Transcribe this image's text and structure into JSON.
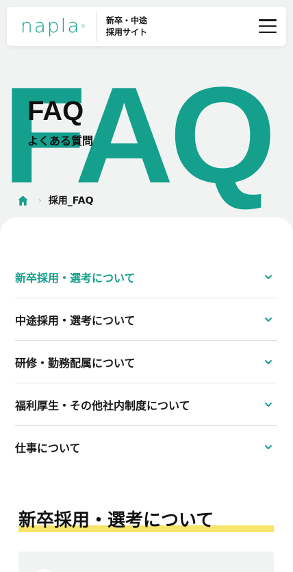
{
  "header": {
    "logo_text": "napla",
    "logo_mark": "®",
    "site_name_line1": "新卒・中途",
    "site_name_line2": "採用サイト",
    "menu_icon": "hamburger-menu-icon"
  },
  "hero": {
    "big_text": "FAQ",
    "title": "FAQ",
    "subtitle": "よくある質問"
  },
  "breadcrumb": {
    "home_icon": "home-icon",
    "separator": "›",
    "current": "採用_FAQ"
  },
  "faq_categories": [
    {
      "label": "新卒採用・選考について",
      "active": true
    },
    {
      "label": "中途採用・選考について",
      "active": false
    },
    {
      "label": "研修・勤務配属について",
      "active": false
    },
    {
      "label": "福利厚生・その他社内制度について",
      "active": false
    },
    {
      "label": "仕事について",
      "active": false
    }
  ],
  "section": {
    "title": "新卒採用・選考について"
  },
  "colors": {
    "brand": "#14a08d",
    "highlight": "#f7e46a",
    "background": "#f1f3f3"
  }
}
